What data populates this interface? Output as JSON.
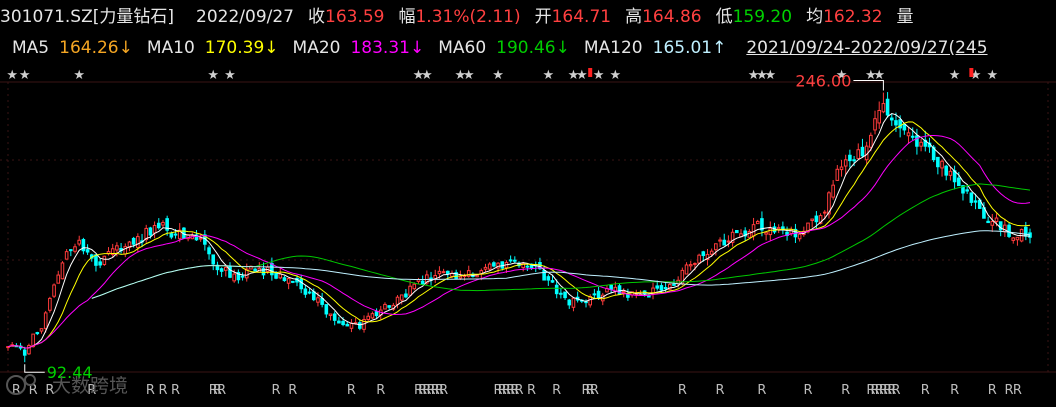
{
  "header": {
    "stock": "301071.SZ[力量钻石]",
    "date": "2022/09/27",
    "close_label": "收",
    "close": "163.59",
    "change_label": "幅",
    "change": "1.31%(2.11)",
    "open_label": "开",
    "open": "164.71",
    "high_label": "高",
    "high": "164.86",
    "low_label": "低",
    "low": "159.20",
    "avg_label": "均",
    "avg": "162.32",
    "vol_label": "量"
  },
  "ma_bar": {
    "ma5_label": "MA5",
    "ma5_value": "164.26↓",
    "ma10_label": "MA10",
    "ma10_value": "170.39↓",
    "ma20_label": "MA20",
    "ma20_value": "183.31↓",
    "ma60_label": "MA60",
    "ma60_value": "190.46↓",
    "ma120_label": "MA120",
    "ma120_value": "165.01↑",
    "range": "2021/09/24-2022/09/27(245"
  },
  "colors": {
    "up": "#ff3b3b",
    "down": "#00ffff",
    "ma5": "#ffffff",
    "ma10": "#ffff00",
    "ma20": "#ff00ff",
    "ma60": "#00c800",
    "ma120": "#bff0ff",
    "ma5_text": "#f5a623",
    "ma10_text": "#ffff00",
    "ma20_text": "#ff00ff",
    "ma60_text": "#00cc00",
    "ma120_text": "#bff0ff"
  },
  "annotations": {
    "max_label": "246.00",
    "min_label": "92.44",
    "watermark": "大数跨境"
  },
  "chart_data": {
    "type": "candlestick",
    "xlim": [
      0,
      244
    ],
    "ylim": [
      88,
      252
    ],
    "max": {
      "index": 209,
      "value": 246.0
    },
    "min": {
      "index": 4,
      "value": 92.44
    },
    "anchors": [
      [
        0,
        103
      ],
      [
        4,
        100
      ],
      [
        8,
        113
      ],
      [
        13,
        150
      ],
      [
        17,
        162
      ],
      [
        21,
        146
      ],
      [
        26,
        157
      ],
      [
        31,
        163
      ],
      [
        36,
        170
      ],
      [
        40,
        166
      ],
      [
        45,
        165
      ],
      [
        50,
        148
      ],
      [
        54,
        141
      ],
      [
        59,
        146
      ],
      [
        64,
        143
      ],
      [
        69,
        137
      ],
      [
        74,
        127
      ],
      [
        79,
        115
      ],
      [
        84,
        114
      ],
      [
        89,
        122
      ],
      [
        94,
        130
      ],
      [
        99,
        139
      ],
      [
        104,
        143
      ],
      [
        109,
        143
      ],
      [
        114,
        145
      ],
      [
        119,
        148
      ],
      [
        124,
        149
      ],
      [
        129,
        139
      ],
      [
        134,
        126
      ],
      [
        139,
        128
      ],
      [
        144,
        133
      ],
      [
        149,
        131
      ],
      [
        154,
        133
      ],
      [
        159,
        138
      ],
      [
        164,
        150
      ],
      [
        169,
        159
      ],
      [
        174,
        166
      ],
      [
        179,
        170
      ],
      [
        184,
        166
      ],
      [
        189,
        164
      ],
      [
        194,
        175
      ],
      [
        199,
        207
      ],
      [
        204,
        213
      ],
      [
        209,
        236
      ],
      [
        214,
        221
      ],
      [
        219,
        215
      ],
      [
        224,
        200
      ],
      [
        229,
        188
      ],
      [
        234,
        175
      ],
      [
        239,
        167
      ],
      [
        244,
        163.59
      ]
    ],
    "ma_periods": [
      5,
      10,
      20,
      60,
      120
    ],
    "ma_last": [
      164.26,
      170.39,
      183.31,
      190.46,
      165.01
    ],
    "events": {
      "star_positions": [
        1,
        4,
        17,
        49,
        53,
        98,
        100,
        108,
        110,
        117,
        129,
        135,
        137,
        141,
        145,
        178,
        180,
        182,
        199,
        206,
        208,
        226,
        231,
        235
      ],
      "red_flags": [
        139,
        230
      ],
      "r_positions": [
        2,
        6,
        10,
        20,
        34,
        37,
        40,
        49,
        50,
        51,
        64,
        68,
        82,
        89,
        98,
        99,
        100,
        101,
        102,
        103,
        104,
        117,
        118,
        119,
        120,
        121,
        122,
        125,
        131,
        138,
        139,
        140,
        161,
        170,
        180,
        191,
        200,
        206,
        207,
        208,
        209,
        210,
        211,
        212,
        219,
        226,
        235,
        239,
        241
      ]
    }
  }
}
